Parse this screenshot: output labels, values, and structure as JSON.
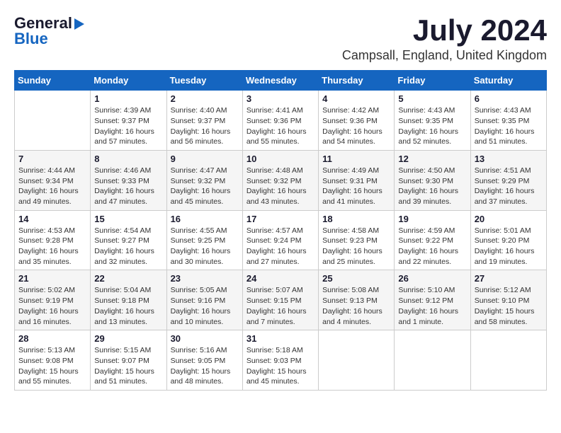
{
  "header": {
    "logo_general": "General",
    "logo_blue": "Blue",
    "month": "July 2024",
    "location": "Campsall, England, United Kingdom"
  },
  "days_of_week": [
    "Sunday",
    "Monday",
    "Tuesday",
    "Wednesday",
    "Thursday",
    "Friday",
    "Saturday"
  ],
  "weeks": [
    [
      {
        "day": "",
        "info": ""
      },
      {
        "day": "1",
        "info": "Sunrise: 4:39 AM\nSunset: 9:37 PM\nDaylight: 16 hours\nand 57 minutes."
      },
      {
        "day": "2",
        "info": "Sunrise: 4:40 AM\nSunset: 9:37 PM\nDaylight: 16 hours\nand 56 minutes."
      },
      {
        "day": "3",
        "info": "Sunrise: 4:41 AM\nSunset: 9:36 PM\nDaylight: 16 hours\nand 55 minutes."
      },
      {
        "day": "4",
        "info": "Sunrise: 4:42 AM\nSunset: 9:36 PM\nDaylight: 16 hours\nand 54 minutes."
      },
      {
        "day": "5",
        "info": "Sunrise: 4:43 AM\nSunset: 9:35 PM\nDaylight: 16 hours\nand 52 minutes."
      },
      {
        "day": "6",
        "info": "Sunrise: 4:43 AM\nSunset: 9:35 PM\nDaylight: 16 hours\nand 51 minutes."
      }
    ],
    [
      {
        "day": "7",
        "info": "Sunrise: 4:44 AM\nSunset: 9:34 PM\nDaylight: 16 hours\nand 49 minutes."
      },
      {
        "day": "8",
        "info": "Sunrise: 4:46 AM\nSunset: 9:33 PM\nDaylight: 16 hours\nand 47 minutes."
      },
      {
        "day": "9",
        "info": "Sunrise: 4:47 AM\nSunset: 9:32 PM\nDaylight: 16 hours\nand 45 minutes."
      },
      {
        "day": "10",
        "info": "Sunrise: 4:48 AM\nSunset: 9:32 PM\nDaylight: 16 hours\nand 43 minutes."
      },
      {
        "day": "11",
        "info": "Sunrise: 4:49 AM\nSunset: 9:31 PM\nDaylight: 16 hours\nand 41 minutes."
      },
      {
        "day": "12",
        "info": "Sunrise: 4:50 AM\nSunset: 9:30 PM\nDaylight: 16 hours\nand 39 minutes."
      },
      {
        "day": "13",
        "info": "Sunrise: 4:51 AM\nSunset: 9:29 PM\nDaylight: 16 hours\nand 37 minutes."
      }
    ],
    [
      {
        "day": "14",
        "info": "Sunrise: 4:53 AM\nSunset: 9:28 PM\nDaylight: 16 hours\nand 35 minutes."
      },
      {
        "day": "15",
        "info": "Sunrise: 4:54 AM\nSunset: 9:27 PM\nDaylight: 16 hours\nand 32 minutes."
      },
      {
        "day": "16",
        "info": "Sunrise: 4:55 AM\nSunset: 9:25 PM\nDaylight: 16 hours\nand 30 minutes."
      },
      {
        "day": "17",
        "info": "Sunrise: 4:57 AM\nSunset: 9:24 PM\nDaylight: 16 hours\nand 27 minutes."
      },
      {
        "day": "18",
        "info": "Sunrise: 4:58 AM\nSunset: 9:23 PM\nDaylight: 16 hours\nand 25 minutes."
      },
      {
        "day": "19",
        "info": "Sunrise: 4:59 AM\nSunset: 9:22 PM\nDaylight: 16 hours\nand 22 minutes."
      },
      {
        "day": "20",
        "info": "Sunrise: 5:01 AM\nSunset: 9:20 PM\nDaylight: 16 hours\nand 19 minutes."
      }
    ],
    [
      {
        "day": "21",
        "info": "Sunrise: 5:02 AM\nSunset: 9:19 PM\nDaylight: 16 hours\nand 16 minutes."
      },
      {
        "day": "22",
        "info": "Sunrise: 5:04 AM\nSunset: 9:18 PM\nDaylight: 16 hours\nand 13 minutes."
      },
      {
        "day": "23",
        "info": "Sunrise: 5:05 AM\nSunset: 9:16 PM\nDaylight: 16 hours\nand 10 minutes."
      },
      {
        "day": "24",
        "info": "Sunrise: 5:07 AM\nSunset: 9:15 PM\nDaylight: 16 hours\nand 7 minutes."
      },
      {
        "day": "25",
        "info": "Sunrise: 5:08 AM\nSunset: 9:13 PM\nDaylight: 16 hours\nand 4 minutes."
      },
      {
        "day": "26",
        "info": "Sunrise: 5:10 AM\nSunset: 9:12 PM\nDaylight: 16 hours\nand 1 minute."
      },
      {
        "day": "27",
        "info": "Sunrise: 5:12 AM\nSunset: 9:10 PM\nDaylight: 15 hours\nand 58 minutes."
      }
    ],
    [
      {
        "day": "28",
        "info": "Sunrise: 5:13 AM\nSunset: 9:08 PM\nDaylight: 15 hours\nand 55 minutes."
      },
      {
        "day": "29",
        "info": "Sunrise: 5:15 AM\nSunset: 9:07 PM\nDaylight: 15 hours\nand 51 minutes."
      },
      {
        "day": "30",
        "info": "Sunrise: 5:16 AM\nSunset: 9:05 PM\nDaylight: 15 hours\nand 48 minutes."
      },
      {
        "day": "31",
        "info": "Sunrise: 5:18 AM\nSunset: 9:03 PM\nDaylight: 15 hours\nand 45 minutes."
      },
      {
        "day": "",
        "info": ""
      },
      {
        "day": "",
        "info": ""
      },
      {
        "day": "",
        "info": ""
      }
    ]
  ]
}
